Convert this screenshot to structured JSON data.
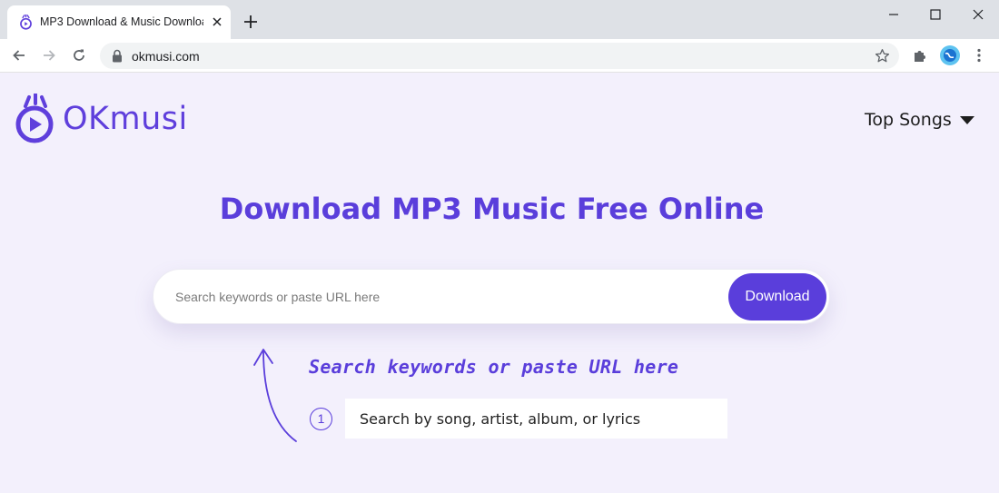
{
  "browser": {
    "tab_title": "MP3 Download & Music Download",
    "url": "okmusi.com"
  },
  "site": {
    "logo_text": "OKmusi",
    "nav_top_songs": "Top Songs",
    "headline": "Download MP3 Music Free Online",
    "search": {
      "placeholder": "Search keywords or paste URL here",
      "value": "",
      "button_label": "Download"
    },
    "hint": {
      "title": "Search keywords or paste URL here",
      "step_number": "1",
      "step_text": "Search by song, artist, album, or lyrics"
    }
  },
  "colors": {
    "accent": "#5a3edb",
    "page_background": "#f3f0fc"
  }
}
